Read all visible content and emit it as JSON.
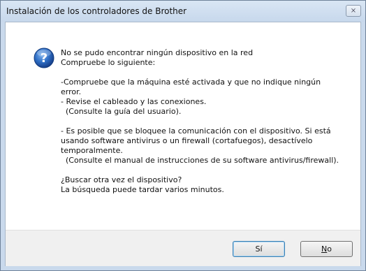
{
  "window": {
    "title": "Instalación de los controladores de Brother",
    "close_glyph": "⨯"
  },
  "message": {
    "line1": "No se pudo encontrar ningún dispositivo en la red",
    "line2": "Compruebe lo siguiente:",
    "line3": "-Compruebe que la máquina esté activada y que no indique ningún",
    "line4": "error.",
    "line5": "- Revise el cableado y las conexiones.",
    "line6": "  (Consulte la guía del usuario).",
    "line7": "- Es posible que se bloquee la comunicación con el dispositivo. Si está",
    "line8": "usando software antivirus o un firewall (cortafuegos), desactívelo",
    "line9": "temporalmente.",
    "line10": "  (Consulte el manual de instrucciones de su software antivirus/firewall).",
    "line11": "¿Buscar otra vez el dispositivo?",
    "line12": "La búsqueda puede tardar varios minutos."
  },
  "buttons": {
    "yes_label": "Sí",
    "no_mnemonic": "N",
    "no_rest": "o"
  },
  "icon": {
    "name": "question-icon",
    "glyph": "?",
    "color": "#2a63b5"
  }
}
